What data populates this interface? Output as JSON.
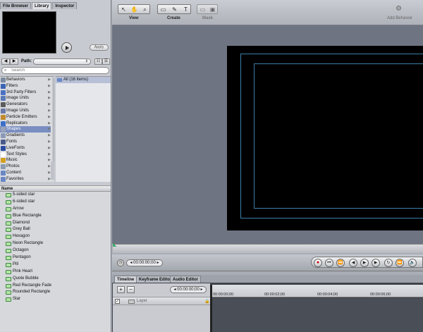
{
  "library": {
    "tabs": [
      "File Browser",
      "Library",
      "Inspector"
    ],
    "active_tab": "Library",
    "apply_label": "Apply",
    "path_label": "Path:",
    "search_placeholder": "Search",
    "categories": [
      {
        "label": "Behaviors",
        "icon": "gear-icon",
        "color": "#7a8aa0"
      },
      {
        "label": "Filters",
        "icon": "filter-icon",
        "color": "#3a64b4"
      },
      {
        "label": "3rd Party Filters",
        "icon": "filter-icon",
        "color": "#4b72c2"
      },
      {
        "label": "Image Units",
        "icon": "image-unit-icon",
        "color": "#5a7ab8"
      },
      {
        "label": "Generators",
        "icon": "generator-icon",
        "color": "#5c5c5c"
      },
      {
        "label": "Image Units",
        "icon": "image-unit-icon",
        "color": "#6a7aa8"
      },
      {
        "label": "Particle Emitters",
        "icon": "particle-icon",
        "color": "#c08a2a"
      },
      {
        "label": "Replicators",
        "icon": "replicator-icon",
        "color": "#3b6fc9"
      },
      {
        "label": "Shapes",
        "icon": "shape-icon",
        "color": "#9aa3b8",
        "selected": true
      },
      {
        "label": "Gradients",
        "icon": "gradient-icon",
        "color": "#8a9ab8"
      },
      {
        "label": "Fonts",
        "icon": "font-icon",
        "color": "#4a5a8a"
      },
      {
        "label": "LiveFonts",
        "icon": "livefont-icon",
        "color": "#2a4aa0"
      },
      {
        "label": "Text Styles",
        "icon": "text-style-icon",
        "color": "#ffffff"
      },
      {
        "label": "Music",
        "icon": "music-icon",
        "color": "#d4a020"
      },
      {
        "label": "Photos",
        "icon": "photo-icon",
        "color": "#8a9ab0"
      },
      {
        "label": "Content",
        "icon": "folder-icon",
        "color": "#6a87c4"
      },
      {
        "label": "Favorites",
        "icon": "folder-icon",
        "color": "#6a87c4"
      }
    ],
    "all_items_label": "All (16 items)",
    "name_header": "Name",
    "shapes": [
      "5-sided star",
      "6-sided star",
      "Arrow",
      "Blue Rectangle",
      "Diamond",
      "Grey Ball",
      "Hexagon",
      "Neon Rectangle",
      "Octagon",
      "Pentagon",
      "Pill",
      "Pink Heart",
      "Quote Bubble",
      "Red Rectangle Fade",
      "Rounded Rectangle",
      "Star"
    ]
  },
  "toolbar": {
    "view_label": "View",
    "create_label": "Create",
    "mask_label": "Mask",
    "add_behavior_label": "Add Behavior",
    "add_filter_label": "Add Filt"
  },
  "transport": {
    "current_time": "00:00:00;00"
  },
  "timeline": {
    "tabs": [
      "Timeline",
      "Keyframe Editor",
      "Audio Editor"
    ],
    "active_tab": "Timeline",
    "time": "00:00:00;00",
    "layer_label": "Layer",
    "ruler_ticks": [
      "00:00:00;00",
      "00:00:02;00",
      "00:00:04;00",
      "00:00:06;00"
    ]
  }
}
